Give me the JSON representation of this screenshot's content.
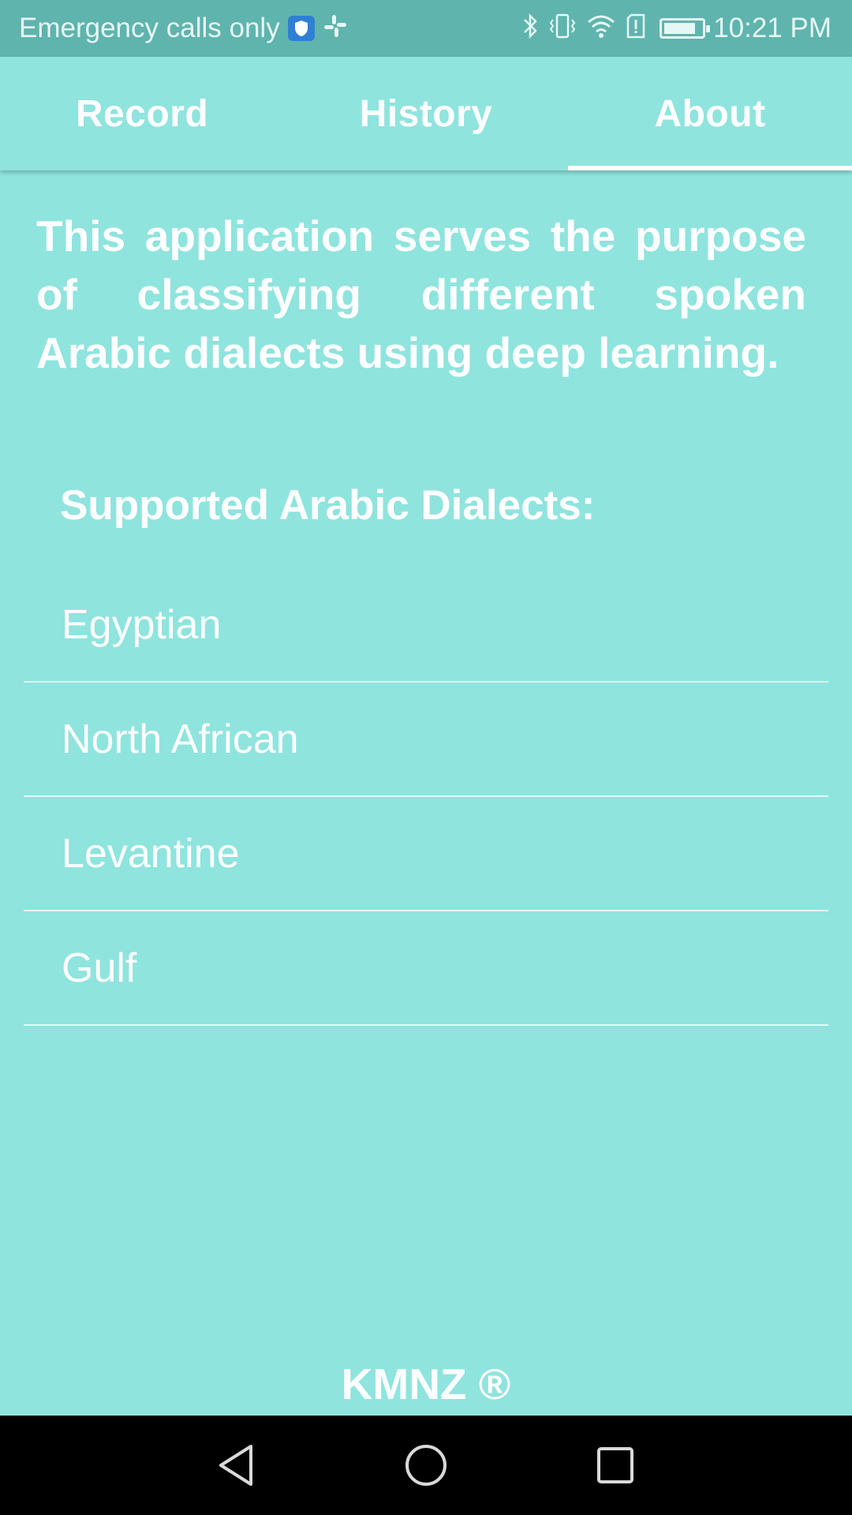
{
  "status_bar": {
    "carrier_text": "Emergency calls only",
    "time": "10:21 PM",
    "icons": [
      "vpn-shield-icon",
      "slack-icon",
      "bluetooth-icon",
      "vibrate-icon",
      "wifi-icon",
      "sim-alert-icon",
      "battery-charging-icon"
    ],
    "battery_level": 0.85
  },
  "tabs": [
    {
      "label": "Record",
      "active": false
    },
    {
      "label": "History",
      "active": false
    },
    {
      "label": "About",
      "active": true
    }
  ],
  "about": {
    "description": "This application serves the purpose of classifying different spoken Arabic dialects using deep learning.",
    "section_title": "Supported Arabic Dialects:",
    "dialects": [
      "Egyptian",
      "North African",
      "Levantine",
      "Gulf"
    ]
  },
  "footer": {
    "brand": "KMNZ ®"
  },
  "nav_bar": {
    "icons": [
      "back-icon",
      "home-icon",
      "recents-icon"
    ]
  },
  "colors": {
    "background": "#8fe4de",
    "status_bar": "#5fb4ae",
    "nav_bar": "#000000",
    "text": "#ffffff"
  }
}
